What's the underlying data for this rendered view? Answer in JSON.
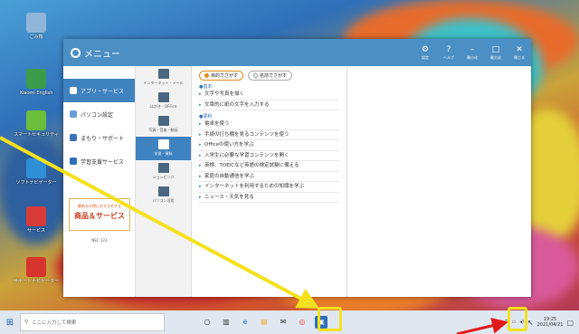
{
  "window": {
    "title": "メニュー",
    "controls": [
      {
        "glyph": "⚙",
        "label": "設定"
      },
      {
        "glyph": "?",
        "label": "ヘルプ"
      },
      {
        "glyph": "–",
        "label": "最小化"
      },
      {
        "glyph": "□",
        "label": "最大化"
      },
      {
        "glyph": "✕",
        "label": "閉じる"
      }
    ]
  },
  "nav": {
    "items": [
      {
        "label": "アプリ・サービス",
        "color": "#3f82c0"
      },
      {
        "label": "パソコン設定",
        "color": "#6aa0d8"
      },
      {
        "label": "まもり・サポート",
        "color": "#3b73b6"
      },
      {
        "label": "学習支援サービス",
        "color": "#2f6fb8"
      }
    ],
    "promo_small": "最新＆お得におすすめする",
    "promo_big": "商品＆サービス",
    "footer": "NEC 123"
  },
  "sub": {
    "items": [
      {
        "label": "インターネット・メール"
      },
      {
        "label": "はがき・OFFice"
      },
      {
        "label": "写真・音楽・動画"
      },
      {
        "label": "学習・資料"
      },
      {
        "label": "ショッピング"
      },
      {
        "label": "パソコン活用"
      }
    ]
  },
  "content": {
    "radio_1": "目的でさがす",
    "radio_2": "名前でさがす",
    "section_1": "●基本",
    "links_1": [
      "文字や写真を描く",
      "文章的に紙の文字を入力する"
    ],
    "section_2": "●便利",
    "links_2": [
      "電卓を使う",
      "手続の打ち棚を見るコンテンツを使う",
      "Officeの使い方を学ぶ",
      "入学生に必要な学習コンテンツを開く",
      "英検、TOEICなど英語の検定試験に備える",
      "家庭の自動通信を学ぶ",
      "インターネットを利用するための知識を学ぶ",
      "ニュース・天気を見る"
    ]
  },
  "desktop_icons": [
    {
      "label": "ごみ箱",
      "color": "#8fb6d8"
    },
    {
      "label": "Xiaomi English",
      "color": "#3a9b4a"
    },
    {
      "label": "スマートセキュリティ",
      "color": "#6cbf3c"
    },
    {
      "label": "ソフトナビゲーター",
      "color": "#2f8fd6"
    },
    {
      "label": "サービス",
      "color": "#d83a3a"
    },
    {
      "label": "サポートナビゲーター",
      "color": "#d6342c"
    }
  ],
  "taskbar": {
    "search_placeholder": "ここに入力して検索",
    "apps": [
      {
        "glyph": "○"
      },
      {
        "glyph": "▥"
      },
      {
        "glyph": "e"
      },
      {
        "glyph": "▤"
      },
      {
        "glyph": "✉"
      },
      {
        "glyph": "◎"
      },
      {
        "glyph": "▣"
      }
    ],
    "time": "19:25",
    "date": "2021/04/21"
  }
}
